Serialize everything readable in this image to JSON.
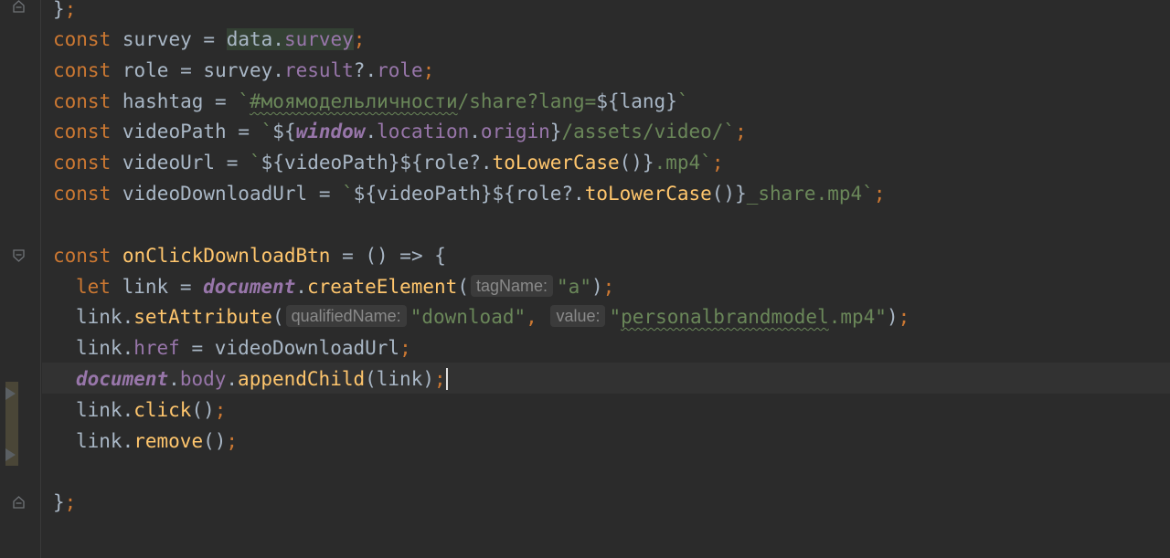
{
  "theme": {
    "background": "#2b2b2b",
    "current_line": "#323232",
    "keyword": "#cc7832",
    "identifier": "#a9b7c6",
    "property": "#9876aa",
    "string": "#6a8759",
    "function": "#ffc66d",
    "hint_background": "#3b3b3b",
    "hint_text": "#8a8a8a",
    "match_highlight": "#344134"
  },
  "gutter": {
    "fold_icons": [
      "fold-end-icon",
      "fold-start-icon",
      "fold-end-icon"
    ],
    "bookmark_icons": [
      "arrow-right-icon",
      "arrow-right-icon"
    ]
  },
  "code": {
    "l0": {
      "brace": "}",
      "semi": ";"
    },
    "l1": {
      "kw": "const",
      "name": "survey",
      "eq": "=",
      "obj": "data",
      "dot": ".",
      "prop": "survey",
      "semi": ";"
    },
    "l2": {
      "kw": "const",
      "name": "role",
      "eq": "=",
      "obj": "survey",
      "dot1": ".",
      "prop1": "result",
      "opt": "?.",
      "prop2": "role",
      "semi": ";"
    },
    "l3": {
      "kw": "const",
      "name": "hashtag",
      "eq": "=",
      "tick": "`",
      "hash": "#моямодельличности",
      "rest": "/share?lang=",
      "interp_open": "${",
      "var": "lang",
      "interp_close": "}",
      "tick2": "`"
    },
    "l4": {
      "kw": "const",
      "name": "videoPath",
      "eq": "=",
      "tick": "`",
      "interp_open": "${",
      "glob": "window",
      "dot1": ".",
      "prop1": "location",
      "dot2": ".",
      "prop2": "origin",
      "interp_close": "}",
      "path": "/assets/video/",
      "tick2": "`",
      "semi": ";"
    },
    "l5": {
      "kw": "const",
      "name": "videoUrl",
      "eq": "=",
      "tick": "`",
      "i1": "${videoPath}",
      "i2open": "${",
      "var": "role",
      "opt": "?.",
      "fn": "toLowerCase",
      "parens": "()",
      "i2close": "}",
      "ext": ".mp4",
      "tick2": "`",
      "semi": ";"
    },
    "l6": {
      "kw": "const",
      "name": "videoDownloadUrl",
      "eq": "=",
      "tick": "`",
      "i1": "${videoPath}",
      "i2open": "${",
      "var": "role",
      "opt": "?.",
      "fn": "toLowerCase",
      "parens": "()",
      "i2close": "}",
      "ext": "_share.mp4",
      "tick2": "`",
      "semi": ";"
    },
    "l8": {
      "kw": "const",
      "name": "onClickDownloadBtn",
      "rest": " = () => {"
    },
    "l9": {
      "kw": "let",
      "name": "link",
      "eq": "=",
      "glob": "document",
      "dot": ".",
      "fn": "createElement",
      "open": "(",
      "hint": "tagName:",
      "arg": "\"a\"",
      "close": ")",
      "semi": ";"
    },
    "l10": {
      "obj": "link",
      "dot": ".",
      "fn": "setAttribute",
      "open": "(",
      "hint1": "qualifiedName:",
      "arg1": "\"download\"",
      "comma": ",",
      "hint2": "value:",
      "q1": "\"",
      "arg2": "personalbrandmodel",
      "arg2ext": ".mp4",
      "q2": "\"",
      "close": ")",
      "semi": ";"
    },
    "l11": {
      "obj": "link",
      "dot": ".",
      "prop": "href",
      "eq": "=",
      "val": "videoDownloadUrl",
      "semi": ";"
    },
    "l12": {
      "glob": "document",
      "dot1": ".",
      "prop": "body",
      "dot2": ".",
      "fn": "appendChild",
      "args": "(link)",
      "semi": ";"
    },
    "l13": {
      "obj": "link",
      "dot": ".",
      "fn": "click",
      "parens": "()",
      "semi": ";"
    },
    "l14": {
      "obj": "link",
      "dot": ".",
      "fn": "remove",
      "parens": "()",
      "semi": ";"
    },
    "l16": {
      "brace": "}",
      "semi": ";"
    }
  }
}
